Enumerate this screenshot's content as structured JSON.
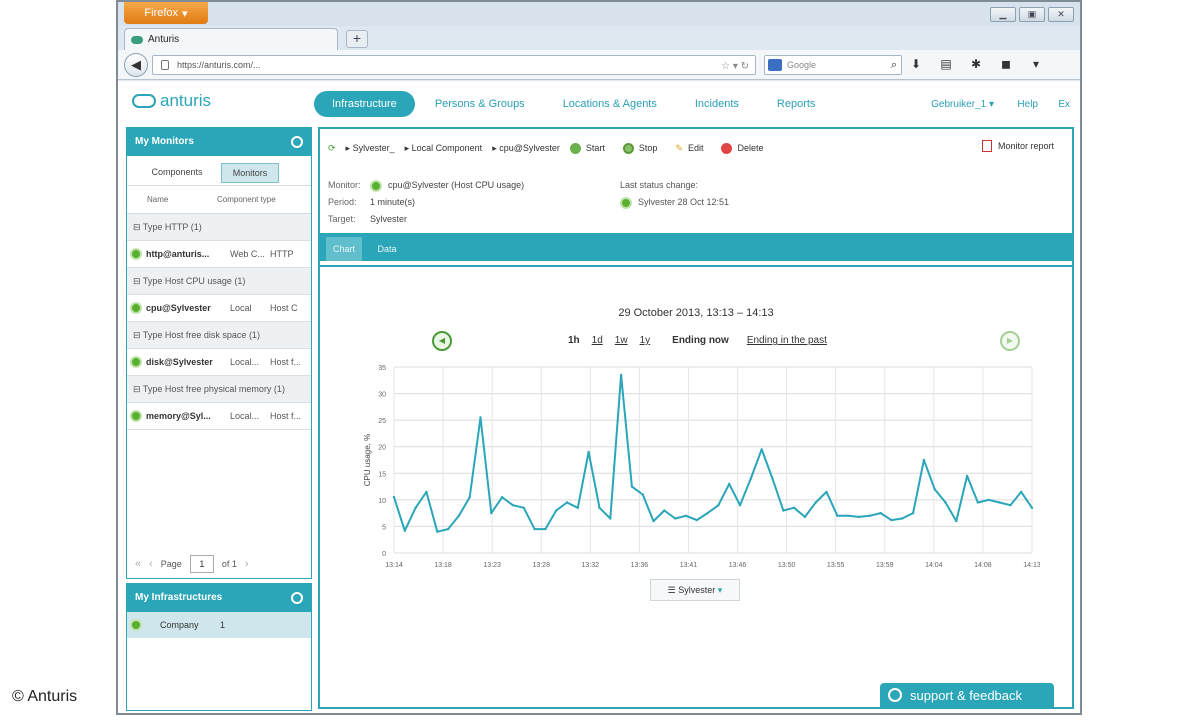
{
  "browser": {
    "firefox_label": "Firefox",
    "tab_title": "Anturis",
    "url": "https://anturis.com/...",
    "search_placeholder": "Google",
    "window_controls": [
      "minimize-icon",
      "maximize-icon",
      "close-icon"
    ]
  },
  "app": {
    "logo_text": "anturis",
    "nav": [
      "Infrastructure",
      "Persons & Groups",
      "Locations & Agents",
      "Incidents",
      "Reports"
    ],
    "user": "Gebruiker_1",
    "help": "Help",
    "logout": "Ex",
    "accent_color": "#2aa6b8"
  },
  "left": {
    "monitors_title": "My Monitors",
    "subtab_components": "Components",
    "subtab_monitors": "Monitors",
    "col_name": "Name",
    "col_type": "Component type",
    "groups": [
      {
        "label": "Type HTTP (1)",
        "monitor": {
          "name": "http@anturis...",
          "comp": "Web C...",
          "type": "HTTP"
        }
      },
      {
        "label": "Type Host CPU usage (1)",
        "monitor": {
          "name": "cpu@Sylvester",
          "comp": "Local",
          "type": "Host C"
        }
      },
      {
        "label": "Type Host free disk space (1)",
        "monitor": {
          "name": "disk@Sylvester",
          "comp": "Local...",
          "type": "Host f..."
        }
      },
      {
        "label": "Type Host free physical memory (1)",
        "monitor": {
          "name": "memory@Syl...",
          "comp": "Local...",
          "type": "Host f..."
        }
      }
    ],
    "pager": {
      "page_label": "Page",
      "page_value": "1",
      "of_label": "of 1"
    },
    "infra_title": "My Infrastructures",
    "infra_name": "Company",
    "infra_count": "1"
  },
  "content": {
    "crumbs": [
      "Sylvester_",
      "Local Component",
      "cpu@Sylvester"
    ],
    "actions": {
      "start": "Start",
      "stop": "Stop",
      "edit": "Edit",
      "delete": "Delete"
    },
    "report_label": "Monitor report",
    "details": {
      "monitor_label": "Monitor:",
      "monitor_value": "cpu@Sylvester (Host CPU usage)",
      "period_label": "Period:",
      "period_value": "1 minute(s)",
      "target_label": "Target:",
      "target_value": "Sylvester"
    },
    "last_change_label": "Last status change:",
    "last_change_value": "Sylvester 28 Oct 12:51",
    "tabs": [
      "Chart",
      "Data"
    ],
    "range_links": [
      "1h",
      "1d",
      "1w",
      "1y"
    ],
    "range_now": "Ending now",
    "range_back": "Ending in the past",
    "legend_label": "Sylvester",
    "support_label": "support & feedback"
  },
  "chart_data": {
    "type": "line",
    "title": "29 October 2013, 13:13 – 14:13",
    "xlabel": "",
    "ylabel": "CPU usage, %",
    "ylim": [
      0,
      35
    ],
    "yticks": [
      0,
      5,
      10,
      15,
      20,
      25,
      30,
      35
    ],
    "xticks": [
      "13:14",
      "13:18",
      "13:23",
      "13:28",
      "13:32",
      "13:36",
      "13:41",
      "13:46",
      "13:50",
      "13:55",
      "13:59",
      "14:04",
      "14:08",
      "14:13"
    ],
    "grid": true,
    "color": "#2aa6b8",
    "series": [
      {
        "name": "Sylvester",
        "values": [
          10.5,
          4.2,
          8.5,
          11.5,
          4,
          4.5,
          7,
          10.5,
          25.5,
          7.5,
          10.5,
          9,
          8.5,
          4.5,
          4.5,
          8,
          9.5,
          8.5,
          19,
          8.5,
          6.5,
          33.5,
          12.5,
          11,
          6,
          8,
          6.5,
          7,
          6.2,
          7.5,
          9,
          13,
          9,
          14,
          19.5,
          14,
          8,
          8.5,
          6.8,
          9.5,
          11.5,
          7,
          7,
          6.8,
          7,
          7.5,
          6.2,
          6.5,
          7.5,
          17.5,
          12,
          9.5,
          6,
          14.5,
          9.5,
          10,
          9.5,
          9,
          11.5,
          8.5
        ]
      }
    ]
  },
  "watermark": "© Anturis"
}
